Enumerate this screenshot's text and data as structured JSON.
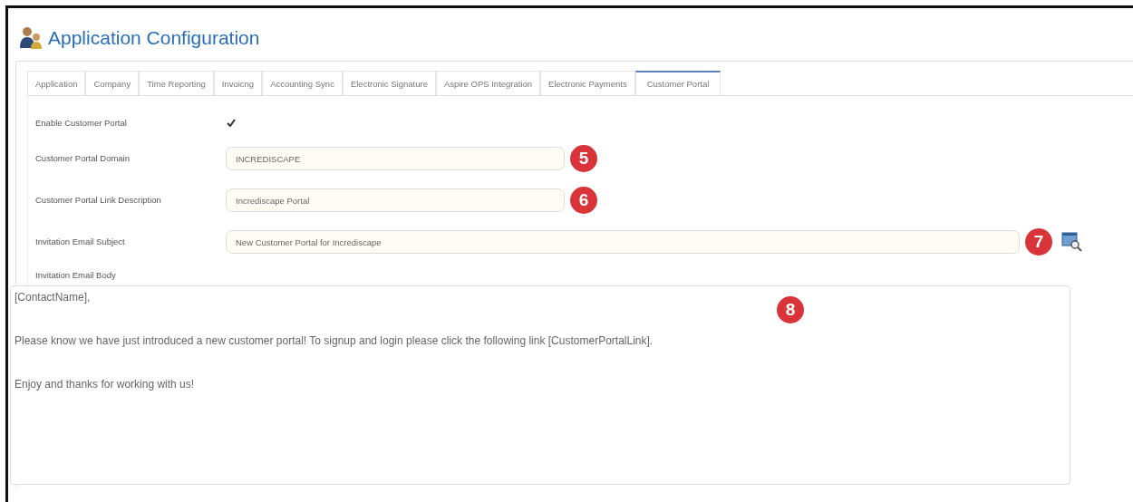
{
  "window": {
    "title": "Application Configuration"
  },
  "tabs": [
    {
      "label": "Application",
      "selected": false
    },
    {
      "label": "Company",
      "selected": false
    },
    {
      "label": "Time Reporting",
      "selected": false
    },
    {
      "label": "Invoicng",
      "selected": false
    },
    {
      "label": "Accounting Sync",
      "selected": false
    },
    {
      "label": "Electronic Signature",
      "selected": false
    },
    {
      "label": "Aspire OPS Integration",
      "selected": false
    },
    {
      "label": "Electronic Payments",
      "selected": false
    },
    {
      "label": "Customer Portal",
      "selected": true
    }
  ],
  "form": {
    "enable": {
      "label": "Enable Customer Portal",
      "checked": true
    },
    "fields": [
      {
        "label": "Customer Portal Domain",
        "value": "INCREDISCAPE",
        "callout": "5",
        "kind": "short"
      },
      {
        "label": "Customer Portal Link Description",
        "value": "Incrediscape Portal",
        "callout": "6",
        "kind": "short"
      },
      {
        "label": "Invitation Email Subject",
        "value": "New Customer Portal for Incrediscape",
        "callout": "7",
        "kind": "wide"
      }
    ],
    "body": {
      "label": "Invitation Email Body",
      "value": "[ContactName],\n\nPlease know we have just introduced a new customer portal! To signup and login please click the following link [CustomerPortalLink].\n\nEnjoy and thanks for working with us!",
      "callout": "8"
    }
  }
}
